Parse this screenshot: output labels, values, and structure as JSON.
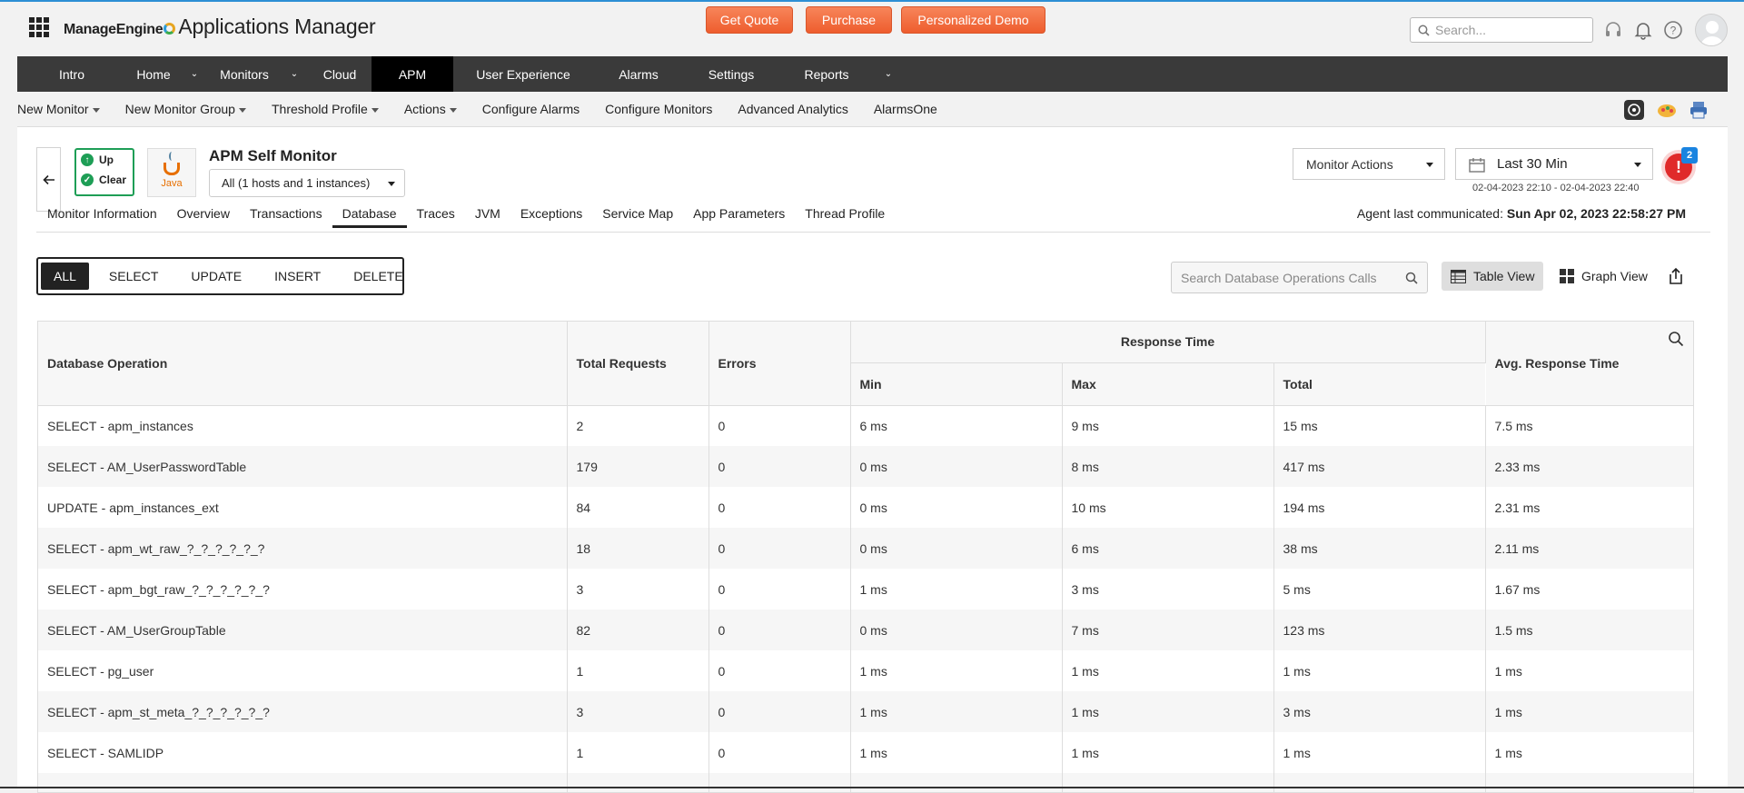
{
  "brand": {
    "company": "ManageEngine",
    "product": "Applications Manager"
  },
  "header": {
    "cta": [
      "Get Quote",
      "Purchase",
      "Personalized Demo"
    ],
    "search_placeholder": "Search...",
    "icons": [
      "headset-icon",
      "bell-icon",
      "help-icon",
      "avatar"
    ]
  },
  "nav": {
    "items": [
      "Intro",
      "Home",
      "Monitors",
      "Cloud",
      "APM",
      "User Experience",
      "Alarms",
      "Settings",
      "Reports"
    ],
    "active": "APM"
  },
  "subnav": {
    "items": [
      "New Monitor",
      "New Monitor Group",
      "Threshold Profile",
      "Actions",
      "Configure Alarms",
      "Configure Monitors",
      "Advanced Analytics",
      "AlarmsOne"
    ]
  },
  "monitor": {
    "status_up": "Up",
    "status_clear": "Clear",
    "logo_text": "Java",
    "title": "APM Self Monitor",
    "host_select": "All (1 hosts and 1 instances)",
    "actions_label": "Monitor Actions",
    "period": "Last 30 Min",
    "range": "02-04-2023 22:10 - 02-04-2023 22:40",
    "alert_count": "2",
    "alert_symbol": "!",
    "agent_label": "Agent last communicated:",
    "agent_time": "Sun Apr 02, 2023 22:58:27 PM"
  },
  "tabs": {
    "items": [
      "Monitor Information",
      "Overview",
      "Transactions",
      "Database",
      "Traces",
      "JVM",
      "Exceptions",
      "Service Map",
      "App Parameters",
      "Thread Profile"
    ],
    "active": "Database"
  },
  "filters": {
    "items": [
      "ALL",
      "SELECT",
      "UPDATE",
      "INSERT",
      "DELETE"
    ],
    "active": "ALL"
  },
  "db_search_placeholder": "Search Database Operations Calls",
  "views": {
    "table": "Table View",
    "graph": "Graph View",
    "active": "Table View"
  },
  "table": {
    "headers": {
      "operation": "Database Operation",
      "total_requests": "Total Requests",
      "errors": "Errors",
      "response_time": "Response Time",
      "min": "Min",
      "max": "Max",
      "total": "Total",
      "avg": "Avg. Response Time"
    },
    "rows": [
      [
        "SELECT - apm_instances",
        "2",
        "0",
        "6 ms",
        "9 ms",
        "15 ms",
        "7.5 ms"
      ],
      [
        "SELECT - AM_UserPasswordTable",
        "179",
        "0",
        "0 ms",
        "8 ms",
        "417 ms",
        "2.33 ms"
      ],
      [
        "UPDATE - apm_instances_ext",
        "84",
        "0",
        "0 ms",
        "10 ms",
        "194 ms",
        "2.31 ms"
      ],
      [
        "SELECT - apm_wt_raw_?_?_?_?_?_?",
        "18",
        "0",
        "0 ms",
        "6 ms",
        "38 ms",
        "2.11 ms"
      ],
      [
        "SELECT - apm_bgt_raw_?_?_?_?_?_?",
        "3",
        "0",
        "1 ms",
        "3 ms",
        "5 ms",
        "1.67 ms"
      ],
      [
        "SELECT - AM_UserGroupTable",
        "82",
        "0",
        "0 ms",
        "7 ms",
        "123 ms",
        "1.5 ms"
      ],
      [
        "SELECT - pg_user",
        "1",
        "0",
        "1 ms",
        "1 ms",
        "1 ms",
        "1 ms"
      ],
      [
        "SELECT - apm_st_meta_?_?_?_?_?_?",
        "3",
        "0",
        "1 ms",
        "1 ms",
        "3 ms",
        "1 ms"
      ],
      [
        "SELECT - SAMLIDP",
        "1",
        "0",
        "1 ms",
        "1 ms",
        "1 ms",
        "1 ms"
      ]
    ]
  }
}
